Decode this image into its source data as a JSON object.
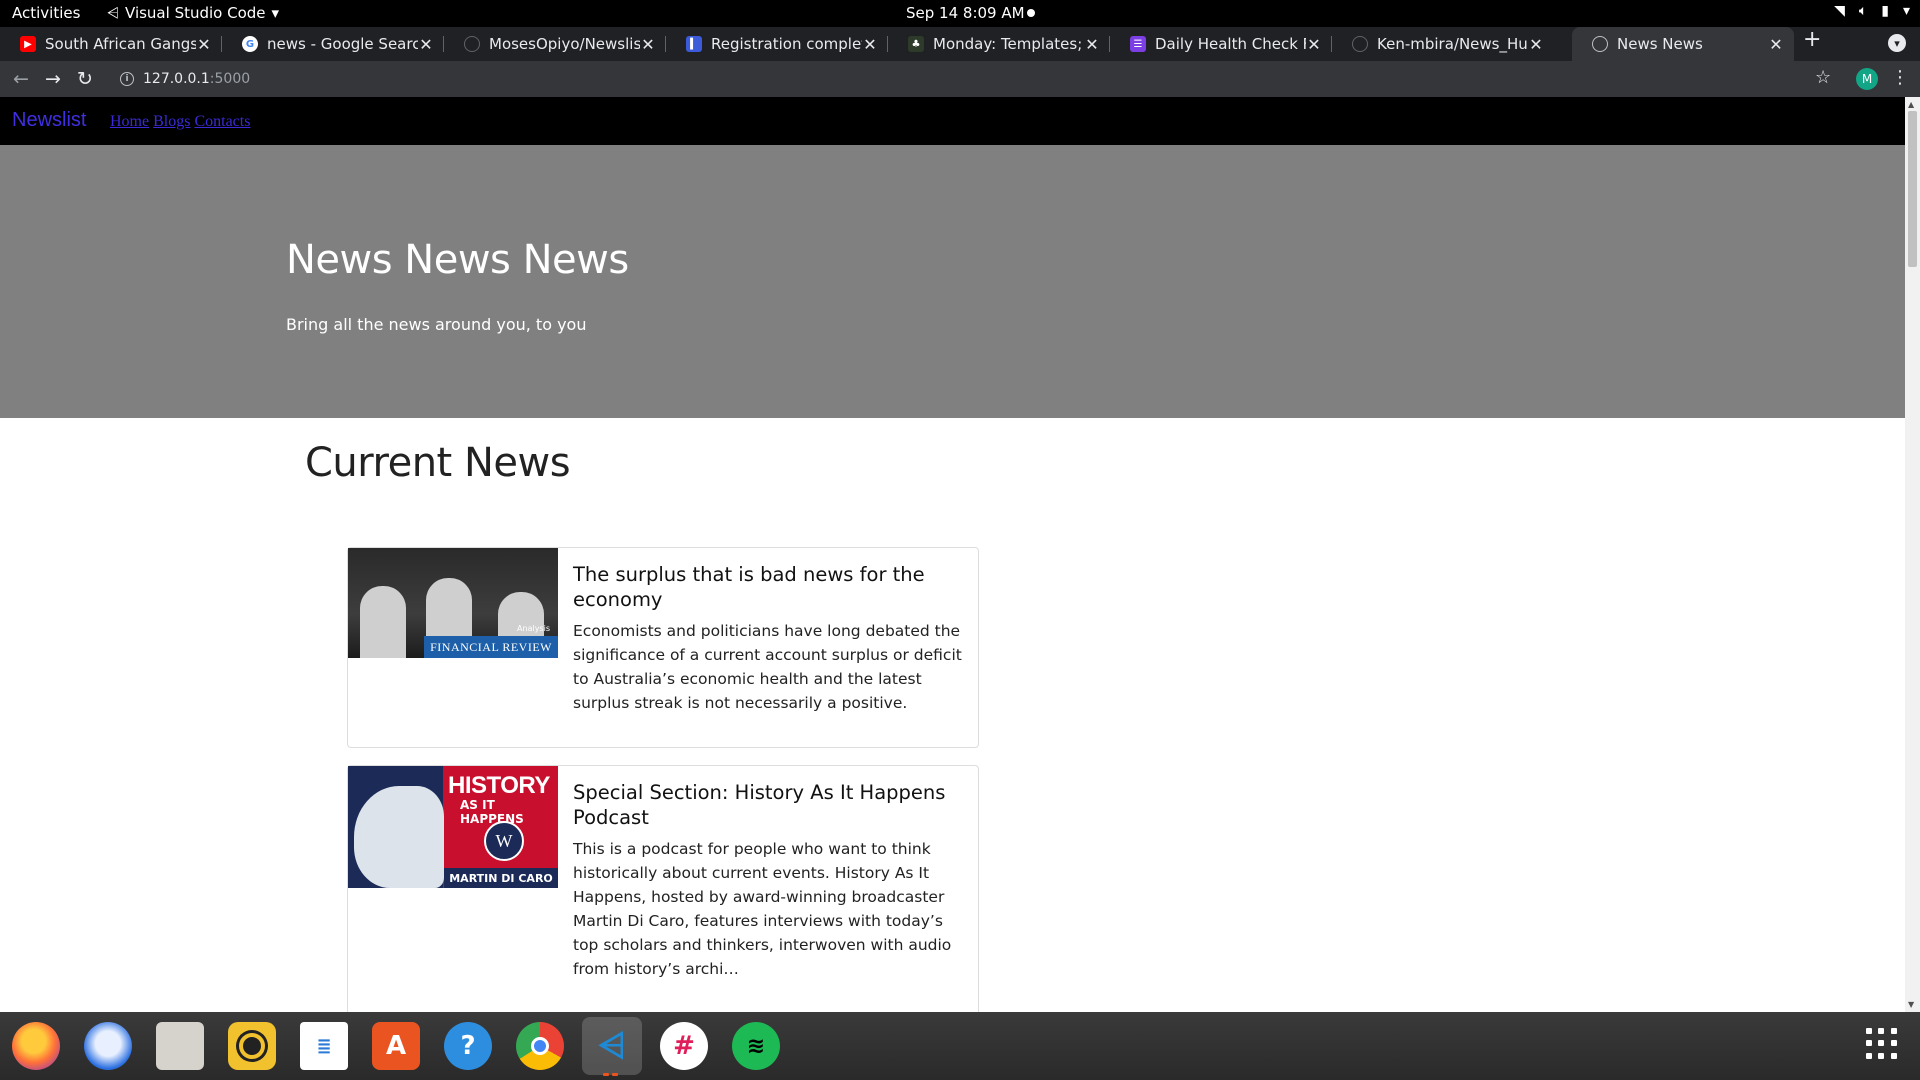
{
  "system_bar": {
    "activities": "Activities",
    "app_name": "Visual Studio Code",
    "clock": "Sep 14  8:09 AM"
  },
  "tabs": [
    {
      "title": "South African Gangster",
      "icon": "youtube-icon",
      "color": "#ff0000"
    },
    {
      "title": "news - Google Search",
      "icon": "google-icon",
      "color": "#4285f4"
    },
    {
      "title": "MosesOpiyo/Newslist",
      "icon": "github-icon",
      "color": "#202124"
    },
    {
      "title": "Registration complete",
      "icon": "doc-icon",
      "color": "#3b5bdb"
    },
    {
      "title": "Monday: Templates; if S",
      "icon": "plant-icon",
      "color": "#2e7d32"
    },
    {
      "title": "Daily Health Check Form",
      "icon": "form-icon",
      "color": "#7b3fe4"
    },
    {
      "title": "Ken-mbira/News_Hub:",
      "icon": "github-icon",
      "color": "#202124"
    },
    {
      "title": "News News",
      "icon": "globe-icon",
      "color": "#9aa0a6"
    }
  ],
  "address_bar": {
    "host": "127.0.0.1",
    "port": ":5000"
  },
  "profile_initial": "M",
  "site": {
    "brand": "Newslist",
    "nav": [
      "Home",
      "Blogs",
      "Contacts"
    ],
    "hero_title": "News News News",
    "hero_subtitle": "Bring all the news around you, to you",
    "section_title": "Current News",
    "articles": [
      {
        "title": "The surplus that is bad news for the economy",
        "description": "Economists and politicians have long debated the significance of a current account surplus or deficit to Australia’s economic health and the latest surplus streak is not necessarily a positive.",
        "image_label": "FINANCIAL REVIEW",
        "image_tag": "Analysis"
      },
      {
        "title": "Special Section: History As It Happens Podcast",
        "description": "This is a podcast for people who want to think historically about current events. History As It Happens, hosted by award-winning broadcaster Martin Di Caro, features interviews with today’s top scholars and thinkers, interwoven with audio from history’s archi…",
        "image_label": "HISTORY",
        "image_sublabel": "AS IT HAPPENS",
        "image_badge": "W",
        "image_author": "MARTIN DI CARO"
      }
    ]
  },
  "dock": [
    {
      "name": "firefox-icon",
      "color": "#ff7139"
    },
    {
      "name": "thunderbird-icon",
      "color": "#2a6ee0"
    },
    {
      "name": "files-icon",
      "color": "#d6d2cc"
    },
    {
      "name": "rhythmbox-icon",
      "color": "#f2c12e"
    },
    {
      "name": "writer-icon",
      "color": "#2a7ad6"
    },
    {
      "name": "software-icon",
      "color": "#e95420"
    },
    {
      "name": "help-icon",
      "color": "#2d8ee0"
    },
    {
      "name": "chrome-icon",
      "color": "#fbbc05"
    },
    {
      "name": "vscode-icon",
      "color": "#1e8ad6"
    },
    {
      "name": "slack-icon",
      "color": "#e01e5a"
    },
    {
      "name": "spotify-icon",
      "color": "#1db954"
    }
  ]
}
